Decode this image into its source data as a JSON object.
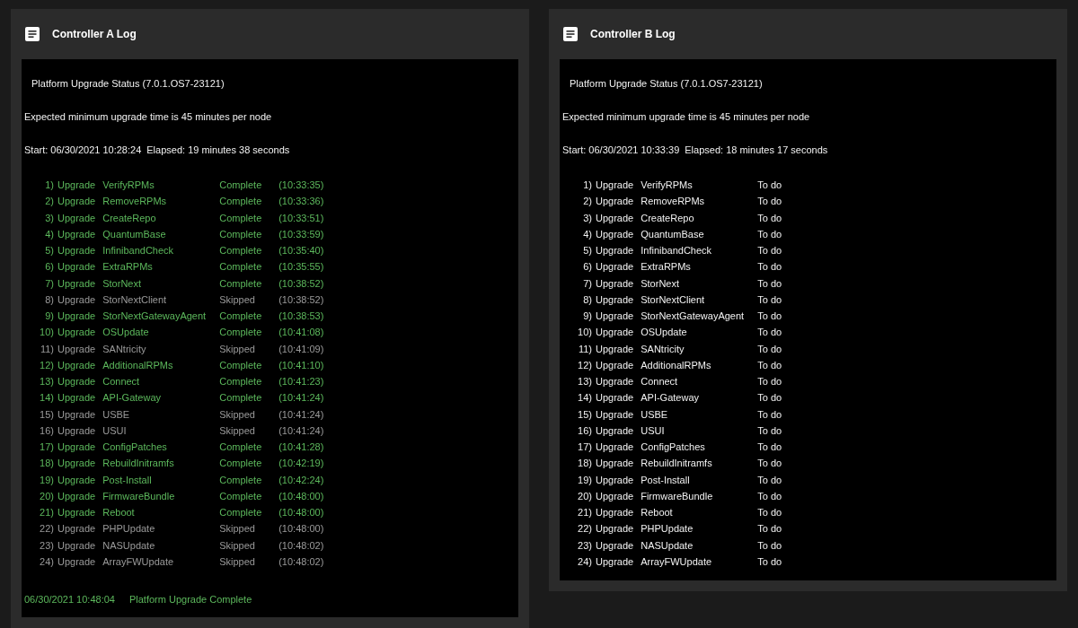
{
  "panels": [
    {
      "title": "Controller A Log",
      "heading": "Platform Upgrade Status (7.0.1.OS7-23121)",
      "expected": "Expected minimum upgrade time is 45 minutes per node",
      "start": "Start: 06/30/2021 10:28:24",
      "elapsed": "Elapsed: 19 minutes 38 seconds",
      "steps": [
        {
          "number": "1)",
          "action": "Upgrade",
          "name": "VerifyRPMs",
          "status": "Complete",
          "time": "(10:33:35)",
          "kind": "complete"
        },
        {
          "number": "2)",
          "action": "Upgrade",
          "name": "RemoveRPMs",
          "status": "Complete",
          "time": "(10:33:36)",
          "kind": "complete"
        },
        {
          "number": "3)",
          "action": "Upgrade",
          "name": "CreateRepo",
          "status": "Complete",
          "time": "(10:33:51)",
          "kind": "complete"
        },
        {
          "number": "4)",
          "action": "Upgrade",
          "name": "QuantumBase",
          "status": "Complete",
          "time": "(10:33:59)",
          "kind": "complete"
        },
        {
          "number": "5)",
          "action": "Upgrade",
          "name": "InfinibandCheck",
          "status": "Complete",
          "time": "(10:35:40)",
          "kind": "complete"
        },
        {
          "number": "6)",
          "action": "Upgrade",
          "name": "ExtraRPMs",
          "status": "Complete",
          "time": "(10:35:55)",
          "kind": "complete"
        },
        {
          "number": "7)",
          "action": "Upgrade",
          "name": "StorNext",
          "status": "Complete",
          "time": "(10:38:52)",
          "kind": "complete"
        },
        {
          "number": "8)",
          "action": "Upgrade",
          "name": "StorNextClient",
          "status": "Skipped",
          "time": "(10:38:52)",
          "kind": "skipped"
        },
        {
          "number": "9)",
          "action": "Upgrade",
          "name": "StorNextGatewayAgent",
          "status": "Complete",
          "time": "(10:38:53)",
          "kind": "complete"
        },
        {
          "number": "10)",
          "action": "Upgrade",
          "name": "OSUpdate",
          "status": "Complete",
          "time": "(10:41:08)",
          "kind": "complete"
        },
        {
          "number": "11)",
          "action": "Upgrade",
          "name": "SANtricity",
          "status": "Skipped",
          "time": "(10:41:09)",
          "kind": "skipped"
        },
        {
          "number": "12)",
          "action": "Upgrade",
          "name": "AdditionalRPMs",
          "status": "Complete",
          "time": "(10:41:10)",
          "kind": "complete"
        },
        {
          "number": "13)",
          "action": "Upgrade",
          "name": "Connect",
          "status": "Complete",
          "time": "(10:41:23)",
          "kind": "complete"
        },
        {
          "number": "14)",
          "action": "Upgrade",
          "name": "API-Gateway",
          "status": "Complete",
          "time": "(10:41:24)",
          "kind": "complete"
        },
        {
          "number": "15)",
          "action": "Upgrade",
          "name": "USBE",
          "status": "Skipped",
          "time": "(10:41:24)",
          "kind": "skipped"
        },
        {
          "number": "16)",
          "action": "Upgrade",
          "name": "USUI",
          "status": "Skipped",
          "time": "(10:41:24)",
          "kind": "skipped"
        },
        {
          "number": "17)",
          "action": "Upgrade",
          "name": "ConfigPatches",
          "status": "Complete",
          "time": "(10:41:28)",
          "kind": "complete"
        },
        {
          "number": "18)",
          "action": "Upgrade",
          "name": "RebuildInitramfs",
          "status": "Complete",
          "time": "(10:42:19)",
          "kind": "complete"
        },
        {
          "number": "19)",
          "action": "Upgrade",
          "name": "Post-Install",
          "status": "Complete",
          "time": "(10:42:24)",
          "kind": "complete"
        },
        {
          "number": "20)",
          "action": "Upgrade",
          "name": "FirmwareBundle",
          "status": "Complete",
          "time": "(10:48:00)",
          "kind": "complete"
        },
        {
          "number": "21)",
          "action": "Upgrade",
          "name": "Reboot",
          "status": "Complete",
          "time": "(10:48:00)",
          "kind": "complete"
        },
        {
          "number": "22)",
          "action": "Upgrade",
          "name": "PHPUpdate",
          "status": "Skipped",
          "time": "(10:48:00)",
          "kind": "skipped"
        },
        {
          "number": "23)",
          "action": "Upgrade",
          "name": "NASUpdate",
          "status": "Skipped",
          "time": "(10:48:02)",
          "kind": "skipped"
        },
        {
          "number": "24)",
          "action": "Upgrade",
          "name": "ArrayFWUpdate",
          "status": "Skipped",
          "time": "(10:48:02)",
          "kind": "skipped"
        }
      ],
      "footer": {
        "time": "06/30/2021 10:48:04",
        "message": "Platform Upgrade Complete"
      }
    },
    {
      "title": "Controller B Log",
      "heading": "Platform Upgrade Status (7.0.1.OS7-23121)",
      "expected": "Expected minimum upgrade time is 45 minutes per node",
      "start": "Start: 06/30/2021 10:33:39",
      "elapsed": "Elapsed: 18 minutes 17 seconds",
      "steps": [
        {
          "number": "1)",
          "action": "Upgrade",
          "name": "VerifyRPMs",
          "status": "To do",
          "kind": "todo"
        },
        {
          "number": "2)",
          "action": "Upgrade",
          "name": "RemoveRPMs",
          "status": "To do",
          "kind": "todo"
        },
        {
          "number": "3)",
          "action": "Upgrade",
          "name": "CreateRepo",
          "status": "To do",
          "kind": "todo"
        },
        {
          "number": "4)",
          "action": "Upgrade",
          "name": "QuantumBase",
          "status": "To do",
          "kind": "todo"
        },
        {
          "number": "5)",
          "action": "Upgrade",
          "name": "InfinibandCheck",
          "status": "To do",
          "kind": "todo"
        },
        {
          "number": "6)",
          "action": "Upgrade",
          "name": "ExtraRPMs",
          "status": "To do",
          "kind": "todo"
        },
        {
          "number": "7)",
          "action": "Upgrade",
          "name": "StorNext",
          "status": "To do",
          "kind": "todo"
        },
        {
          "number": "8)",
          "action": "Upgrade",
          "name": "StorNextClient",
          "status": "To do",
          "kind": "todo"
        },
        {
          "number": "9)",
          "action": "Upgrade",
          "name": "StorNextGatewayAgent",
          "status": "To do",
          "kind": "todo"
        },
        {
          "number": "10)",
          "action": "Upgrade",
          "name": "OSUpdate",
          "status": "To do",
          "kind": "todo"
        },
        {
          "number": "11)",
          "action": "Upgrade",
          "name": "SANtricity",
          "status": "To do",
          "kind": "todo"
        },
        {
          "number": "12)",
          "action": "Upgrade",
          "name": "AdditionalRPMs",
          "status": "To do",
          "kind": "todo"
        },
        {
          "number": "13)",
          "action": "Upgrade",
          "name": "Connect",
          "status": "To do",
          "kind": "todo"
        },
        {
          "number": "14)",
          "action": "Upgrade",
          "name": "API-Gateway",
          "status": "To do",
          "kind": "todo"
        },
        {
          "number": "15)",
          "action": "Upgrade",
          "name": "USBE",
          "status": "To do",
          "kind": "todo"
        },
        {
          "number": "16)",
          "action": "Upgrade",
          "name": "USUI",
          "status": "To do",
          "kind": "todo"
        },
        {
          "number": "17)",
          "action": "Upgrade",
          "name": "ConfigPatches",
          "status": "To do",
          "kind": "todo"
        },
        {
          "number": "18)",
          "action": "Upgrade",
          "name": "RebuildInitramfs",
          "status": "To do",
          "kind": "todo"
        },
        {
          "number": "19)",
          "action": "Upgrade",
          "name": "Post-Install",
          "status": "To do",
          "kind": "todo"
        },
        {
          "number": "20)",
          "action": "Upgrade",
          "name": "FirmwareBundle",
          "status": "To do",
          "kind": "todo"
        },
        {
          "number": "21)",
          "action": "Upgrade",
          "name": "Reboot",
          "status": "To do",
          "kind": "todo"
        },
        {
          "number": "22)",
          "action": "Upgrade",
          "name": "PHPUpdate",
          "status": "To do",
          "kind": "todo"
        },
        {
          "number": "23)",
          "action": "Upgrade",
          "name": "NASUpdate",
          "status": "To do",
          "kind": "todo"
        },
        {
          "number": "24)",
          "action": "Upgrade",
          "name": "ArrayFWUpdate",
          "status": "To do",
          "kind": "todo"
        }
      ]
    }
  ]
}
